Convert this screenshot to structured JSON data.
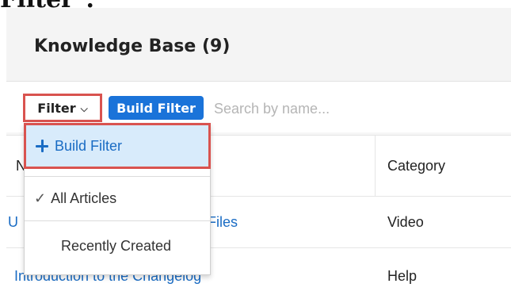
{
  "caption_cut": "Filter\".",
  "header": {
    "title": "Knowledge Base (9)"
  },
  "toolbar": {
    "filter_label": "Filter",
    "build_filter_label": "Build Filter",
    "search_placeholder": "Search by name..."
  },
  "dropdown": {
    "build_filter": "Build Filter",
    "all_articles": "All Articles",
    "recently_created": "Recently Created"
  },
  "table": {
    "name_header_partial": "N",
    "category_header": "Category",
    "rows": [
      {
        "name_left": "U",
        "name_right": "Files",
        "category": "Video"
      },
      {
        "name": "Introduction to the Changelog",
        "category": "Help"
      }
    ]
  },
  "colors": {
    "accent": "#1a73d9",
    "link": "#1a6cc4",
    "highlight": "#d9534f",
    "selected_bg": "#d8ebfb"
  }
}
